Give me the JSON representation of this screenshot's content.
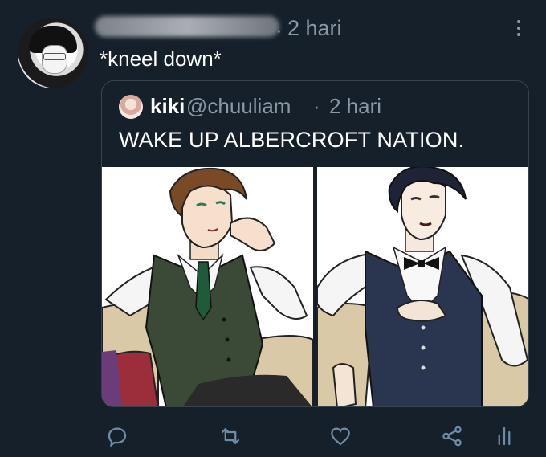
{
  "tweet": {
    "time": "2 hari",
    "separator": "·",
    "text": "*kneel down*"
  },
  "quoted": {
    "name": "kiki",
    "handle": "@chuuliam",
    "separator": "·",
    "time": "2 hari",
    "text": "WAKE UP ALBERCROFT NATION."
  },
  "actions": {
    "reply_icon": "reply-icon",
    "retweet_icon": "retweet-icon",
    "like_icon": "like-icon",
    "share_icon": "share-icon",
    "analytics_icon": "analytics-icon"
  },
  "colors": {
    "background": "#15202b",
    "secondary_text": "#8b98a5",
    "border": "#38444d",
    "icon": "#6e8ca8"
  }
}
